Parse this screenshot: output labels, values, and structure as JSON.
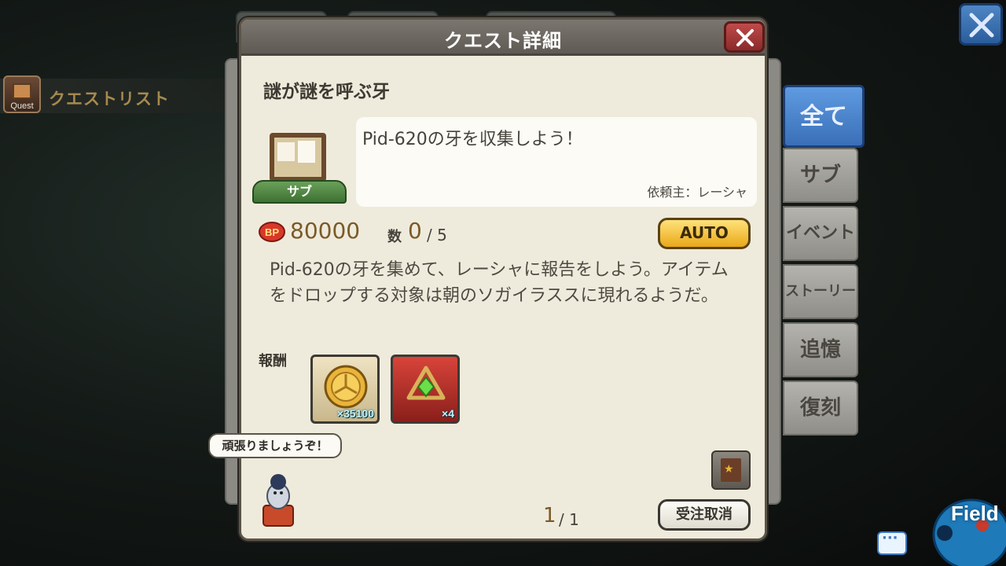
{
  "quest_list": {
    "icon_label": "Quest",
    "title": "クエストリスト"
  },
  "tabs": [
    {
      "label": "全て",
      "active": true
    },
    {
      "label": "サブ"
    },
    {
      "label": "イベント"
    },
    {
      "label": "ストーリー"
    },
    {
      "label": "追憶"
    },
    {
      "label": "復刻"
    }
  ],
  "panel": {
    "title": "クエスト詳細",
    "quest_name": "謎が謎を呼ぶ牙",
    "category_badge": "サブ",
    "objective": "Pid-620の牙を収集しよう！",
    "requester": "依頼主：レーシャ",
    "bp_value": "80000",
    "count_label": "数",
    "count_current": "0",
    "count_total": "/ 5",
    "auto_label": "AUTO",
    "description": "Pid-620の牙を集めて、レーシャに報告をしよう。アイテムをドロップする対象は朝のソガイラススに現れるようだ。",
    "reward_label": "報酬",
    "rewards": [
      {
        "icon": "coin-icon",
        "qty": "×35100"
      },
      {
        "icon": "gem-amulet-icon",
        "qty": "×4"
      }
    ],
    "speech": "頑張りましょうぞ！",
    "page_current": "1",
    "page_total": "/ 1",
    "cancel_label": "受注取消"
  },
  "field_label": "Field",
  "colors": {
    "accent_blue": "#3a6fb8",
    "auto_gold": "#e9a818",
    "close_red": "#8a2a2a",
    "panel_bg": "#efebdc"
  }
}
